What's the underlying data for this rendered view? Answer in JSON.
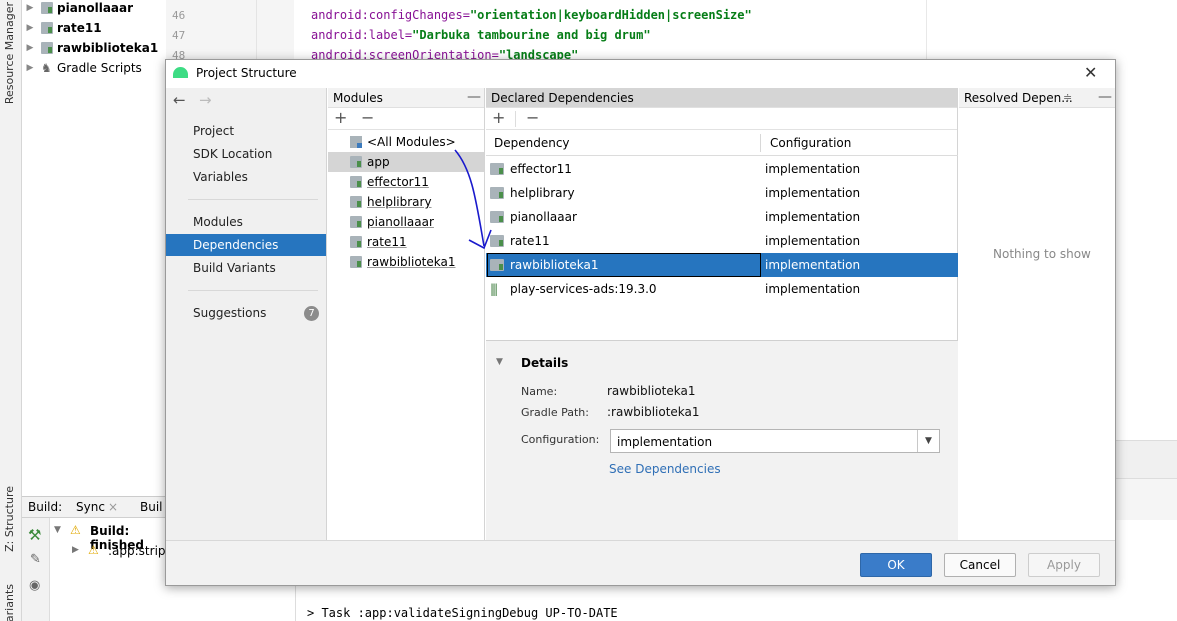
{
  "ide": {
    "left_tabs": {
      "resource_manager": "Resource Manager",
      "structure": "Z: Structure",
      "variants": "Variants"
    },
    "project_tree": [
      {
        "label": "pianollaaar",
        "bold": true
      },
      {
        "label": "rate11",
        "bold": true
      },
      {
        "label": "rawbiblioteka1",
        "bold": true
      },
      {
        "label": "Gradle Scripts",
        "bold": false
      }
    ],
    "editor": {
      "line_numbers": [
        "46",
        "47",
        "48"
      ],
      "lines": [
        {
          "attr": "android:configChanges=",
          "value": "\"orientation|keyboardHidden|screenSize\""
        },
        {
          "attr": "android:label=",
          "value": "\"Darbuka tambourine and big drum\""
        },
        {
          "attr": "android:screenOrientation=",
          "value": "\"landscape\""
        }
      ]
    },
    "build_bar": {
      "build_label": "Build:",
      "sync_tab": "Sync",
      "close": "×",
      "build_tab": "Buil"
    },
    "build_output": {
      "line1": "Build: finished",
      "line2": ":app:stripD"
    },
    "console": "> Task :app:validateSigningDebug UP-TO-DATE"
  },
  "dialog": {
    "title": "Project Structure",
    "close": "✕",
    "nav": {
      "back": "←",
      "forward": "→",
      "items": [
        "Project",
        "SDK Location",
        "Variables"
      ],
      "items2": [
        "Modules",
        "Dependencies",
        "Build Variants"
      ],
      "suggestions": "Suggestions",
      "suggestions_count": "7",
      "selected": "Dependencies"
    },
    "modules": {
      "header": "Modules",
      "add": "+",
      "remove": "−",
      "minimize": "—",
      "items": [
        "<All Modules>",
        "app",
        "effector11",
        "helplibrary",
        "pianollaaar",
        "rate11",
        "rawbiblioteka1"
      ],
      "selected": "app"
    },
    "declared": {
      "header": "Declared Dependencies",
      "add": "+",
      "remove": "−",
      "columns": {
        "dependency": "Dependency",
        "configuration": "Configuration"
      },
      "rows": [
        {
          "name": "effector11",
          "conf": "implementation",
          "type": "module"
        },
        {
          "name": "helplibrary",
          "conf": "implementation",
          "type": "module"
        },
        {
          "name": "pianollaaar",
          "conf": "implementation",
          "type": "module"
        },
        {
          "name": "rate11",
          "conf": "implementation",
          "type": "module"
        },
        {
          "name": "rawbiblioteka1",
          "conf": "implementation",
          "type": "module"
        },
        {
          "name": "play-services-ads:19.3.0",
          "conf": "implementation",
          "type": "library"
        }
      ],
      "selected": "rawbiblioteka1"
    },
    "details": {
      "title": "Details",
      "name_label": "Name:",
      "name_value": "rawbiblioteka1",
      "path_label": "Gradle Path:",
      "path_value": ":rawbiblioteka1",
      "config_label": "Configuration:",
      "config_value": "implementation",
      "link": "See Dependencies"
    },
    "resolved": {
      "header": "Resolved Depen...",
      "empty": "Nothing to show"
    },
    "buttons": {
      "ok": "OK",
      "cancel": "Cancel",
      "apply": "Apply"
    }
  },
  "colors": {
    "selection": "#2675bf",
    "ok_button": "#3a7cc9",
    "annotation": "#1a1acc"
  }
}
